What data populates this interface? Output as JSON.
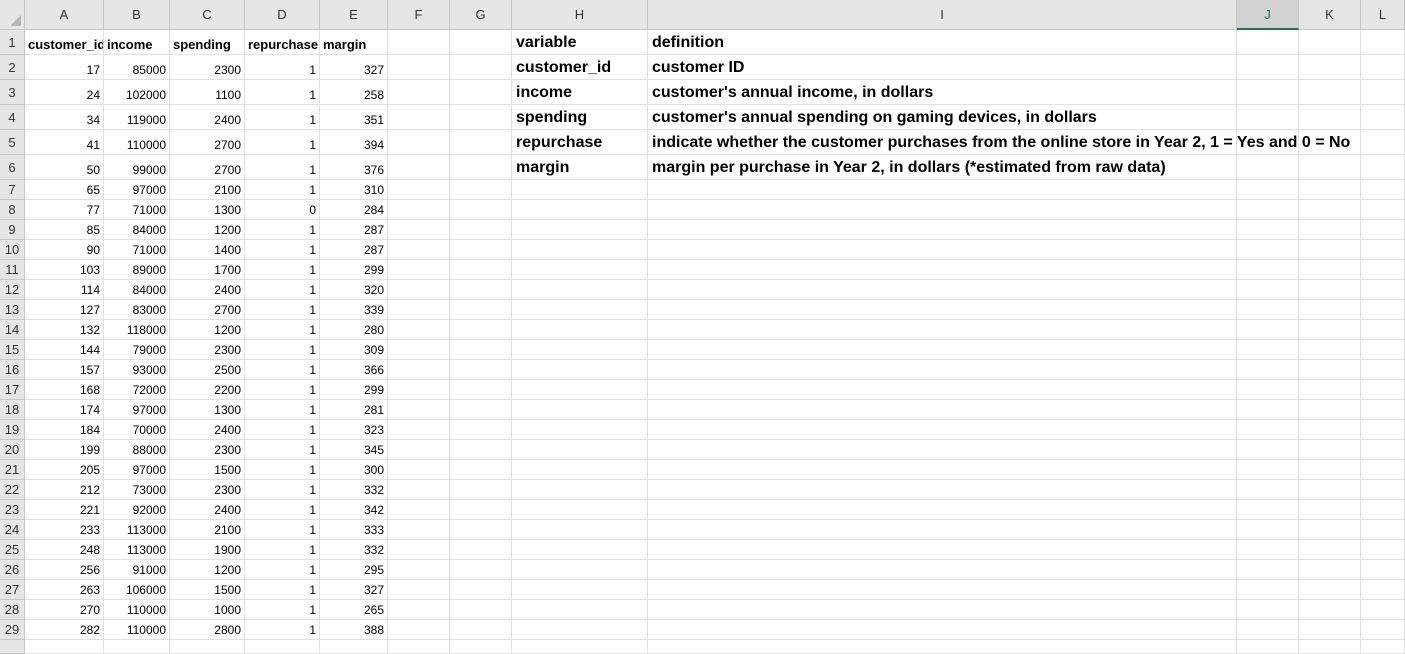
{
  "columns": [
    "A",
    "B",
    "C",
    "D",
    "E",
    "F",
    "G",
    "H",
    "I",
    "J",
    "K",
    "L"
  ],
  "selected_column": "J",
  "header_row": [
    "customer_id",
    "income",
    "spending",
    "repurchase",
    "margin"
  ],
  "rows": [
    [
      17,
      85000,
      2300,
      1,
      327
    ],
    [
      24,
      102000,
      1100,
      1,
      258
    ],
    [
      34,
      119000,
      2400,
      1,
      351
    ],
    [
      41,
      110000,
      2700,
      1,
      394
    ],
    [
      50,
      99000,
      2700,
      1,
      376
    ],
    [
      65,
      97000,
      2100,
      1,
      310
    ],
    [
      77,
      71000,
      1300,
      0,
      284
    ],
    [
      85,
      84000,
      1200,
      1,
      287
    ],
    [
      90,
      71000,
      1400,
      1,
      287
    ],
    [
      103,
      89000,
      1700,
      1,
      299
    ],
    [
      114,
      84000,
      2400,
      1,
      320
    ],
    [
      127,
      83000,
      2700,
      1,
      339
    ],
    [
      132,
      118000,
      1200,
      1,
      280
    ],
    [
      144,
      79000,
      2300,
      1,
      309
    ],
    [
      157,
      93000,
      2500,
      1,
      366
    ],
    [
      168,
      72000,
      2200,
      1,
      299
    ],
    [
      174,
      97000,
      1300,
      1,
      281
    ],
    [
      184,
      70000,
      2400,
      1,
      323
    ],
    [
      199,
      88000,
      2300,
      1,
      345
    ],
    [
      205,
      97000,
      1500,
      1,
      300
    ],
    [
      212,
      73000,
      2300,
      1,
      332
    ],
    [
      221,
      92000,
      2400,
      1,
      342
    ],
    [
      233,
      113000,
      2100,
      1,
      333
    ],
    [
      248,
      113000,
      1900,
      1,
      332
    ],
    [
      256,
      91000,
      1200,
      1,
      295
    ],
    [
      263,
      106000,
      1500,
      1,
      327
    ],
    [
      270,
      110000,
      1000,
      1,
      265
    ],
    [
      282,
      110000,
      2800,
      1,
      388
    ]
  ],
  "definitions": [
    [
      "variable",
      "definition"
    ],
    [
      "customer_id",
      "customer ID"
    ],
    [
      "income",
      "customer's annual income, in dollars"
    ],
    [
      "spending",
      "customer's annual spending on gaming devices, in dollars"
    ],
    [
      "repurchase",
      "indicate whether the customer purchases from the online store in Year 2, 1 = Yes and 0 = No"
    ],
    [
      "margin",
      "margin per purchase in Year 2, in dollars (*estimated from raw data)"
    ]
  ]
}
